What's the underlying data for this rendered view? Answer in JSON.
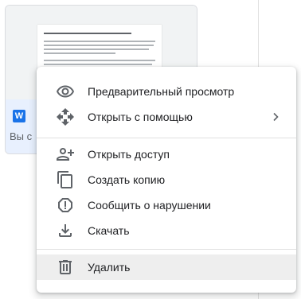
{
  "file_card": {
    "type_icon_letter": "W",
    "subtitle": "Вы с"
  },
  "context_menu": {
    "items": [
      {
        "label": "Предварительный просмотр",
        "icon": "eye-icon"
      },
      {
        "label": "Открыть с помощью",
        "icon": "move-arrows-icon",
        "has_submenu": true
      },
      {
        "label": "Открыть доступ",
        "icon": "add-person-icon"
      },
      {
        "label": "Создать копию",
        "icon": "copy-icon"
      },
      {
        "label": "Сообщить о нарушении",
        "icon": "report-icon"
      },
      {
        "label": "Скачать",
        "icon": "download-icon"
      },
      {
        "label": "Удалить",
        "icon": "trash-icon",
        "hovered": true
      }
    ]
  },
  "colors": {
    "icon_color": "#5f6368",
    "text_color": "#202124",
    "hover_bg": "#eeeeee",
    "card_footer_bg": "#e8f0fe",
    "word_blue": "#1a73e8"
  }
}
